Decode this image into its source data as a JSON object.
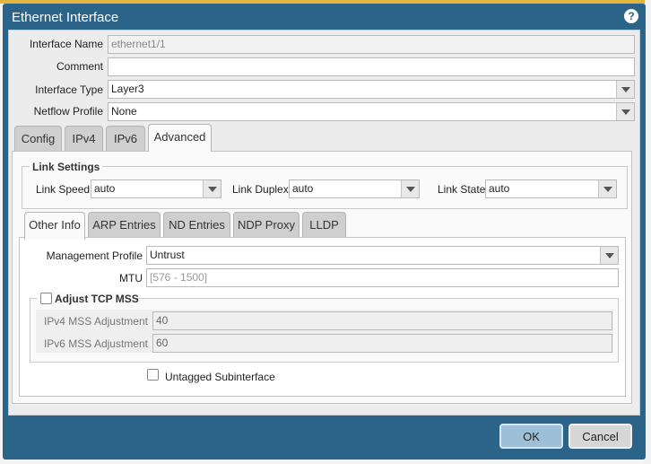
{
  "dialog": {
    "title": "Ethernet Interface",
    "help_icon": "question-circle-icon"
  },
  "fields": {
    "interface_name": {
      "label": "Interface Name",
      "value": "ethernet1/1"
    },
    "comment": {
      "label": "Comment",
      "value": ""
    },
    "interface_type": {
      "label": "Interface Type",
      "value": "Layer3"
    },
    "netflow_profile": {
      "label": "Netflow Profile",
      "value": "None"
    }
  },
  "tabs": [
    {
      "label": "Config"
    },
    {
      "label": "IPv4"
    },
    {
      "label": "IPv6"
    },
    {
      "label": "Advanced",
      "active": true
    }
  ],
  "link_settings": {
    "legend": "Link Settings",
    "speed": {
      "label": "Link Speed",
      "value": "auto"
    },
    "duplex": {
      "label": "Link Duplex",
      "value": "auto"
    },
    "state": {
      "label": "Link State",
      "value": "auto"
    }
  },
  "sub_tabs": [
    {
      "label": "Other Info",
      "active": true
    },
    {
      "label": "ARP Entries"
    },
    {
      "label": "ND Entries"
    },
    {
      "label": "NDP Proxy"
    },
    {
      "label": "LLDP"
    }
  ],
  "other_info": {
    "management_profile": {
      "label": "Management Profile",
      "value": "Untrust"
    },
    "mtu": {
      "label": "MTU",
      "placeholder": "[576 - 1500]"
    },
    "adjust_tcp_mss": {
      "label": "Adjust TCP MSS",
      "checked": false,
      "ipv4": {
        "label": "IPv4 MSS Adjustment",
        "value": "40"
      },
      "ipv6": {
        "label": "IPv6 MSS Adjustment",
        "value": "60"
      }
    },
    "untagged_subinterface": {
      "label": "Untagged Subinterface",
      "checked": false
    }
  },
  "buttons": {
    "ok": "OK",
    "cancel": "Cancel"
  },
  "colors": {
    "dialog_header": "#2b6488",
    "ok_button": "#9dc0d8",
    "accent_bar": "#e1b33f"
  }
}
